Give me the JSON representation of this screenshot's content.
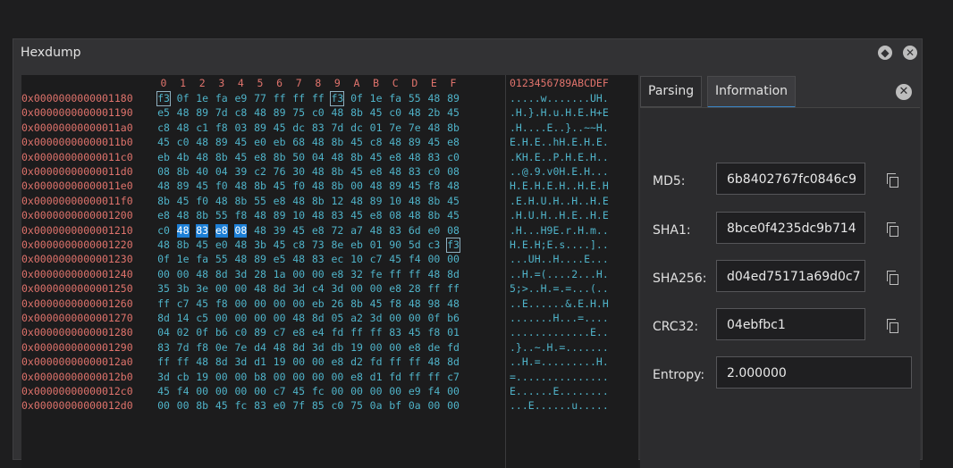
{
  "window": {
    "title": "Hexdump"
  },
  "hexdump": {
    "column_headers": [
      "0",
      "1",
      "2",
      "3",
      "4",
      "5",
      "6",
      "7",
      "8",
      "9",
      "A",
      "B",
      "C",
      "D",
      "E",
      "F"
    ],
    "ascii_header": "0123456789ABCDEF",
    "rows": [
      {
        "addr": "0x0000000000001180",
        "bytes": "f3 0f 1e fa e9 77 ff ff ff f3 0f 1e fa 55 48 89",
        "ascii": ".....w.......UH."
      },
      {
        "addr": "0x0000000000001190",
        "bytes": "e5 48 89 7d c8 48 89 75 c0 48 8b 45 c0 48 2b 45",
        "ascii": ".H.}.H.u.H.E.H+E"
      },
      {
        "addr": "0x00000000000011a0",
        "bytes": "c8 48 c1 f8 03 89 45 dc 83 7d dc 01 7e 7e 48 8b",
        "ascii": ".H....E..}..~~H."
      },
      {
        "addr": "0x00000000000011b0",
        "bytes": "45 c0 48 89 45 e0 eb 68 48 8b 45 c8 48 89 45 e8",
        "ascii": "E.H.E..hH.E.H.E."
      },
      {
        "addr": "0x00000000000011c0",
        "bytes": "eb 4b 48 8b 45 e8 8b 50 04 48 8b 45 e8 48 83 c0",
        "ascii": ".KH.E..P.H.E.H.."
      },
      {
        "addr": "0x00000000000011d0",
        "bytes": "08 8b 40 04 39 c2 76 30 48 8b 45 e8 48 83 c0 08",
        "ascii": "..@.9.v0H.E.H..."
      },
      {
        "addr": "0x00000000000011e0",
        "bytes": "48 89 45 f0 48 8b 45 f0 48 8b 00 48 89 45 f8 48",
        "ascii": "H.E.H.E.H..H.E.H"
      },
      {
        "addr": "0x00000000000011f0",
        "bytes": "8b 45 f0 48 8b 55 e8 48 8b 12 48 89 10 48 8b 45",
        "ascii": ".E.H.U.H..H..H.E"
      },
      {
        "addr": "0x0000000000001200",
        "bytes": "e8 48 8b 55 f8 48 89 10 48 83 45 e8 08 48 8b 45",
        "ascii": ".H.U.H..H.E..H.E"
      },
      {
        "addr": "0x0000000000001210",
        "bytes": "c0 48 83 e8 08 48 39 45 e8 72 a7 48 83 6d e0 08",
        "ascii": ".H...H9E.r.H.m.."
      },
      {
        "addr": "0x0000000000001220",
        "bytes": "48 8b 45 e0 48 3b 45 c8 73 8e eb 01 90 5d c3 f3",
        "ascii": "H.E.H;E.s....].."
      },
      {
        "addr": "0x0000000000001230",
        "bytes": "0f 1e fa 55 48 89 e5 48 83 ec 10 c7 45 f4 00 00",
        "ascii": "...UH..H....E..."
      },
      {
        "addr": "0x0000000000001240",
        "bytes": "00 00 48 8d 3d 28 1a 00 00 e8 32 fe ff ff 48 8d",
        "ascii": "..H.=(....2...H."
      },
      {
        "addr": "0x0000000000001250",
        "bytes": "35 3b 3e 00 00 48 8d 3d c4 3d 00 00 e8 28 ff ff",
        "ascii": "5;>..H.=.=...(.."
      },
      {
        "addr": "0x0000000000001260",
        "bytes": "ff c7 45 f8 00 00 00 00 eb 26 8b 45 f8 48 98 48",
        "ascii": "..E......&.E.H.H"
      },
      {
        "addr": "0x0000000000001270",
        "bytes": "8d 14 c5 00 00 00 00 48 8d 05 a2 3d 00 00 0f b6",
        "ascii": ".......H...=...."
      },
      {
        "addr": "0x0000000000001280",
        "bytes": "04 02 0f b6 c0 89 c7 e8 e4 fd ff ff 83 45 f8 01",
        "ascii": ".............E.."
      },
      {
        "addr": "0x0000000000001290",
        "bytes": "83 7d f8 0e 7e d4 48 8d 3d db 19 00 00 e8 de fd",
        "ascii": ".}..~.H.=......."
      },
      {
        "addr": "0x00000000000012a0",
        "bytes": "ff ff 48 8d 3d d1 19 00 00 e8 d2 fd ff ff 48 8d",
        "ascii": "..H.=.........H."
      },
      {
        "addr": "0x00000000000012b0",
        "bytes": "3d cb 19 00 00 b8 00 00 00 00 e8 d1 fd ff ff c7",
        "ascii": "=..............."
      },
      {
        "addr": "0x00000000000012c0",
        "bytes": "45 f4 00 00 00 00 c7 45 fc 00 00 00 00 e9 f4 00",
        "ascii": "E......E........"
      },
      {
        "addr": "0x00000000000012d0",
        "bytes": "00 00 8b 45 fc 83 e0 7f 85 c0 75 0a bf 0a 00 00",
        "ascii": "...E......u....."
      }
    ]
  },
  "tabs": [
    {
      "label": "Parsing"
    },
    {
      "label": "Information"
    }
  ],
  "info": {
    "md5_label": "MD5:",
    "md5_value": "6b8402767fc0846c9",
    "sha1_label": "SHA1:",
    "sha1_value": "8bce0f4235dc9b714",
    "sha256_label": "SHA256:",
    "sha256_value": "d04ed75171a69d0c7",
    "crc32_label": "CRC32:",
    "crc32_value": "04ebfbc1",
    "entropy_label": "Entropy:",
    "entropy_value": "2.000000"
  },
  "icons": {
    "float": "float-icon",
    "close": "close-icon",
    "copy": "copy-icon"
  },
  "colors": {
    "address": "#e0736c",
    "bytes": "#4fb3c9",
    "selection": "#1d7fd6",
    "accent": "#3a86c8"
  }
}
